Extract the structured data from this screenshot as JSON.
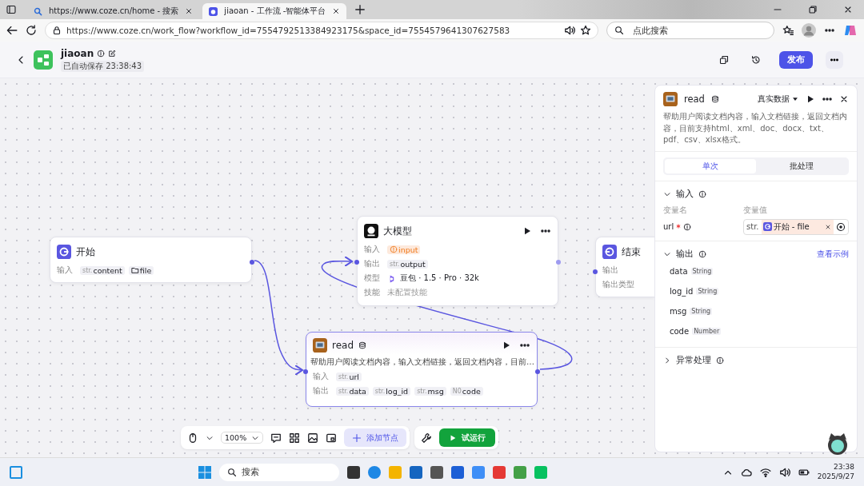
{
  "browser": {
    "tabs": [
      {
        "title": "https://www.coze.cn/home - 搜索",
        "selected": false
      },
      {
        "title": "jiaoan - 工作流 -智能体平台",
        "selected": true
      }
    ],
    "url": "https://www.coze.cn/work_flow?workflow_id=7554792513384923175&space_id=7554579641307627583",
    "search_placeholder": "点此搜索"
  },
  "header": {
    "name": "jiaoan",
    "autosave": "已自动保存 23:38:43",
    "publish": "发布"
  },
  "nodes": [
    {
      "kind": "start",
      "title": "开始",
      "rows": [
        {
          "label": "输入",
          "chips": [
            {
              "kind": "typed",
              "prefix": "str.",
              "text": "content"
            },
            {
              "kind": "file",
              "text": "file"
            }
          ]
        }
      ]
    },
    {
      "kind": "llm",
      "title": "大模型",
      "rows": [
        {
          "label": "输入",
          "chips": [
            {
              "kind": "warning",
              "text": "input"
            }
          ]
        },
        {
          "label": "输出",
          "chips": [
            {
              "kind": "typed",
              "prefix": "str.",
              "text": "output"
            }
          ]
        },
        {
          "label": "模型",
          "model": "豆包 · 1.5 · Pro · 32k"
        },
        {
          "label": "技能",
          "note": "未配置技能"
        }
      ]
    },
    {
      "kind": "end",
      "title": "结束",
      "rows": [
        {
          "label": "输出"
        },
        {
          "label": "输出类型"
        }
      ]
    },
    {
      "kind": "plugin",
      "title": "read",
      "description": "帮助用户阅读文档内容，输入文档链接，返回文档内容，目前…",
      "rows": [
        {
          "label": "输入",
          "chips": [
            {
              "kind": "typed",
              "prefix": "str.",
              "text": "url"
            }
          ]
        },
        {
          "label": "输出",
          "chips": [
            {
              "kind": "typed",
              "prefix": "str.",
              "text": "data"
            },
            {
              "kind": "typed",
              "prefix": "str.",
              "text": "log_id"
            },
            {
              "kind": "typed",
              "prefix": "str.",
              "text": "msg"
            },
            {
              "kind": "typed",
              "prefix": "N0",
              "text": "code"
            }
          ]
        }
      ]
    }
  ],
  "panel": {
    "title": "read",
    "data_source": "真实数据",
    "description": "帮助用户阅读文档内容，输入文档链接，返回文档内容，目前支持html、xml、doc、docx、txt、pdf、csv、xlsx格式。",
    "tabs": [
      {
        "label": "单次",
        "selected": true
      },
      {
        "label": "批处理",
        "selected": false
      }
    ],
    "input": {
      "title": "输入",
      "expanded": true,
      "name_header": "变量名",
      "value_header": "变量值",
      "params": [
        {
          "name": "url",
          "required": true,
          "prefix": "str.",
          "ref": "开始 - file"
        }
      ]
    },
    "output": {
      "title": "输出",
      "expanded": true,
      "link": "查看示例",
      "fields": [
        {
          "name": "data",
          "type": "String"
        },
        {
          "name": "log_id",
          "type": "String"
        },
        {
          "name": "msg",
          "type": "String"
        },
        {
          "name": "code",
          "type": "Number"
        }
      ]
    },
    "exception": {
      "title": "异常处理",
      "expanded": false
    }
  },
  "toolbar": {
    "zoom": "100%",
    "add_node": "添加节点",
    "test_run": "试运行"
  },
  "taskbar": {
    "search_placeholder": "搜索",
    "time": "23:38",
    "date": "2025/9/27"
  }
}
